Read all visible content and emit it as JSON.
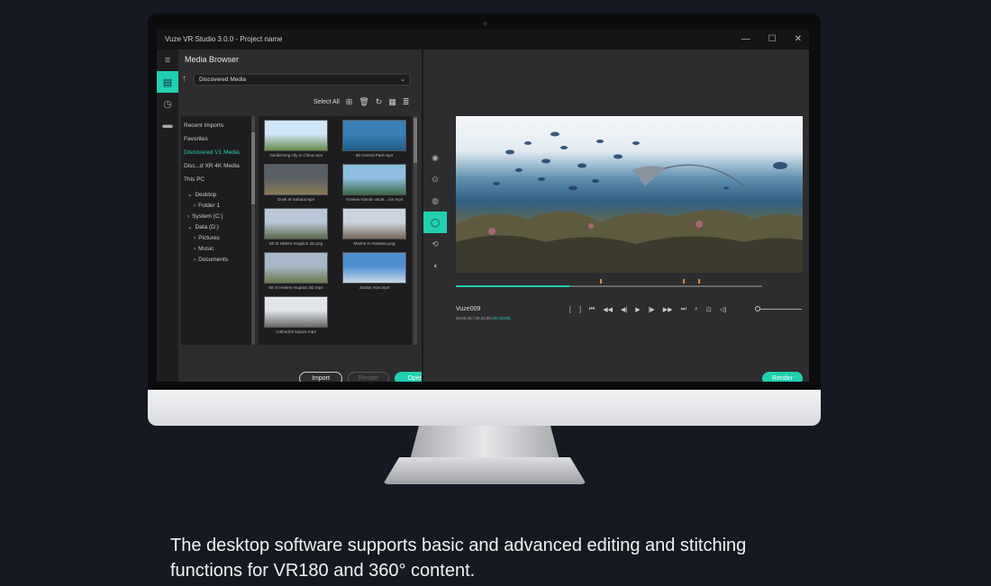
{
  "app": {
    "title": "Vuze VR Studio 3.0.0 - Project name",
    "window_controls": {
      "minimize": "—",
      "maximize": "☐",
      "close": "✕"
    }
  },
  "iconbar": {
    "items": [
      {
        "icon": "menu-icon",
        "glyph": "≡"
      },
      {
        "icon": "media-icon",
        "glyph": "▤"
      },
      {
        "icon": "timer-icon",
        "glyph": "◷"
      },
      {
        "icon": "film-icon",
        "glyph": "▬"
      }
    ]
  },
  "media_browser": {
    "title": "Media Browser",
    "up_glyph": "↑",
    "source_dropdown": "Discovered Media",
    "chevron": "⌄",
    "select_all": "Select All",
    "tool_glyphs": {
      "add_folder": "⊞",
      "delete": "🗑",
      "refresh": "↻",
      "grid_view": "▦",
      "list_view": "≣"
    },
    "tree": {
      "top": [
        "Recent Imports",
        "Favorites",
        "Discovered V1 Media",
        "Disc...d XR 4K Media",
        "This PC"
      ],
      "active_index": 2,
      "nodes": [
        {
          "label": "Desktop",
          "arrow": "⌄",
          "indent": 0
        },
        {
          "label": "Folder 1",
          "arrow": "›",
          "indent": 1
        },
        {
          "label": "System (C:)",
          "arrow": "›",
          "indent": 0
        },
        {
          "label": "Data (D:)",
          "arrow": "⌄",
          "indent": 0
        },
        {
          "label": "Pictures",
          "arrow": "›",
          "indent": 1
        },
        {
          "label": "Music",
          "arrow": "›",
          "indent": 1
        },
        {
          "label": "Documents",
          "arrow": "›",
          "indent": 1
        }
      ]
    },
    "thumbnails": [
      {
        "caption": "Yandicheng city in China.mp4",
        "colors": [
          "#cfe6f8",
          "#6a8a4a"
        ]
      },
      {
        "caption": "60 Central Park.mp4",
        "colors": [
          "#3a7fb5",
          "#1f5f8a"
        ]
      },
      {
        "caption": "Dusk at Sahara.mp4",
        "colors": [
          "#5a5f66",
          "#8a7a55"
        ]
      },
      {
        "caption": "Yosewa islands vacat....ion.mp4",
        "colors": [
          "#8fbfe0",
          "#3a6a4a"
        ]
      },
      {
        "caption": "Mt St Helens eruption 2D.png",
        "colors": [
          "#b8c8d8",
          "#5a6a4a"
        ]
      },
      {
        "caption": "Marine in Atacama.png",
        "colors": [
          "#c9d4de",
          "#7a6a5a"
        ]
      },
      {
        "caption": "Mt St Helens eruption 3D.mp4",
        "colors": [
          "#a8b8c8",
          "#6a7a4a"
        ]
      },
      {
        "caption": "Jordan river.mp4",
        "colors": [
          "#4f8fd0",
          "#c8d8e8"
        ]
      },
      {
        "caption": "Cathedral square.mp4",
        "colors": [
          "#e0e4e8",
          "#6a6a6a"
        ]
      }
    ],
    "buttons": {
      "import": "Import",
      "render": "Render",
      "open": "Open"
    }
  },
  "preview": {
    "side_tool_glyphs": [
      "◉",
      "⊙",
      "◍",
      "◯",
      "⟲",
      "◖"
    ],
    "active_tool_index": 3,
    "clip_name": "Vuze009",
    "time_current": "00:05:30 / 00:24:09",
    "time_extra": "(00:10:09)",
    "progress_fraction": 0.37,
    "marker_fractions": [
      0.47,
      0.74,
      0.79
    ],
    "transport_glyphs": [
      "[",
      "]",
      "⏮",
      "◀◀",
      "◀|",
      "▶",
      "|▶",
      "▶▶",
      "⏭",
      "⌕",
      "⊡",
      "◁)"
    ],
    "render_button": "Render"
  },
  "caption": "The desktop software supports basic and advanced editing and stitching functions for VR180 and 360° content."
}
